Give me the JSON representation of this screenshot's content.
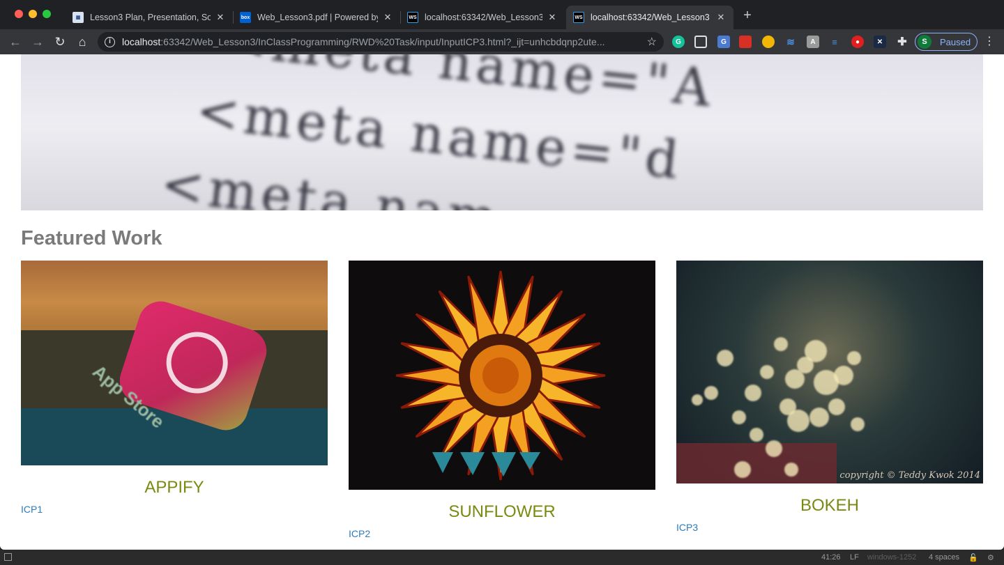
{
  "browser": {
    "tabs": [
      {
        "title": "Lesson3 Plan, Presentation, So",
        "favicon": "doc-icon",
        "active": false
      },
      {
        "title": "Web_Lesson3.pdf | Powered by",
        "favicon": "box-icon",
        "active": false
      },
      {
        "title": "localhost:63342/Web_Lesson3",
        "favicon": "webstorm-icon",
        "active": false
      },
      {
        "title": "localhost:63342/Web_Lesson3",
        "favicon": "webstorm-icon",
        "active": true
      }
    ],
    "url_host": "localhost",
    "url_rest": ":63342/Web_Lesson3/InClassProgramming/RWD%20Task/input/InputICP3.html?_ijt=unhcbdqnp2ute...",
    "profile_initial": "S",
    "profile_label": "Paused",
    "favicon_text": {
      "box": "box",
      "ws": "WS"
    }
  },
  "page": {
    "hero_lines": [
      "<meta    name=\"A",
      "<meta   name=\"d",
      "<meta  nam"
    ],
    "section_title": "Featured Work",
    "cards": [
      {
        "image": "App Store icon photo",
        "app_label": "App Store",
        "caption": "APPIFY",
        "link": "ICP1"
      },
      {
        "image": "sunflower photo",
        "caption": "SUNFLOWER",
        "link": "ICP2"
      },
      {
        "image": "bokeh photo",
        "caption": "BOKEH",
        "link": "ICP3",
        "watermark": "copyright © Teddy Kwok 2014"
      }
    ]
  },
  "statusbar": {
    "position": "41:26",
    "line_ending": "LF",
    "encoding": "windows-1252",
    "indent": "4 spaces"
  },
  "colors": {
    "caption": "#7a8a10",
    "link": "#2b7bbd",
    "section_title": "#7a7a7a"
  }
}
